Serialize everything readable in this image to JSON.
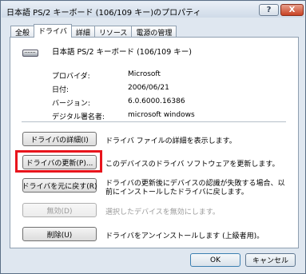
{
  "window": {
    "title": "日本語 PS/2 キーボード (106/109 キー)のプロパティ",
    "help_label": "?",
    "close_label": "X"
  },
  "tabs": [
    {
      "label": "全般"
    },
    {
      "label": "ドライバ"
    },
    {
      "label": "詳細"
    },
    {
      "label": "リソース"
    },
    {
      "label": "電源の管理"
    }
  ],
  "device": {
    "name": "日本語 PS/2 キーボード (106/109 キー)",
    "icon": "keyboard-icon"
  },
  "properties": [
    {
      "label": "プロバイダ:",
      "value": "Microsoft"
    },
    {
      "label": "日付:",
      "value": "2006/06/21"
    },
    {
      "label": "バージョン:",
      "value": "6.0.6000.16386"
    },
    {
      "label": "デジタル署名者:",
      "value": "microsoft windows"
    }
  ],
  "actions": [
    {
      "button": "ドライバの詳細(I)",
      "description": "ドライバ ファイルの詳細を表示します。"
    },
    {
      "button": "ドライバの更新(P)...",
      "description": "このデバイスのドライバ ソフトウェアを更新します。"
    },
    {
      "button": "ドライバを元に戻す(R)",
      "description": "ドライバの更新後にデバイスの認識が失敗する場合、以",
      "description2": "前にインストールしたドライバに戻します。"
    },
    {
      "button": "無効(D)",
      "description": "選択したデバイスを無効にします。"
    },
    {
      "button": "削除(U)",
      "description": "ドライバをアンインストールします (上級者用)。"
    }
  ],
  "footer": {
    "ok_label": "OK",
    "cancel_label": "キャンセル"
  },
  "highlight_color": "#e8141c"
}
